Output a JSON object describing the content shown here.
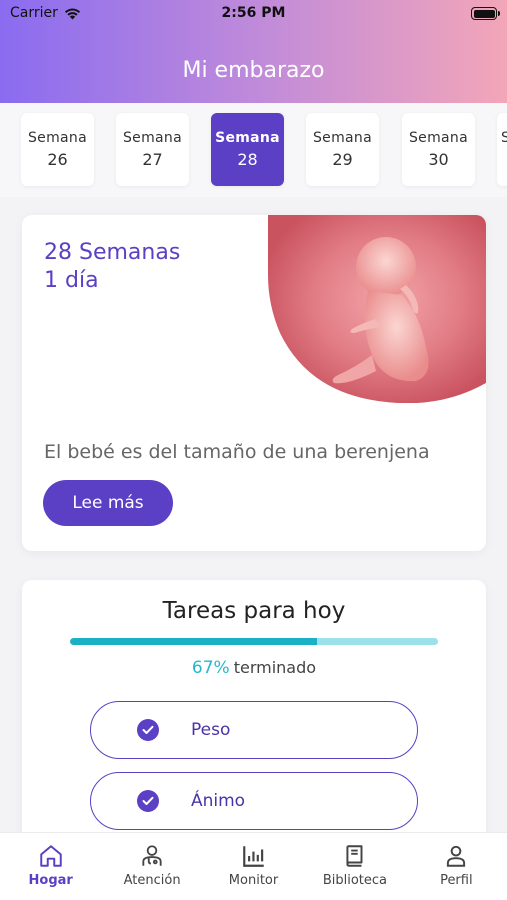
{
  "status_bar": {
    "carrier": "Carrier",
    "time": "2:56 PM"
  },
  "header": {
    "title": "Mi embarazo"
  },
  "weeks": {
    "label": "Semana",
    "items": [
      {
        "num": "26"
      },
      {
        "num": "27"
      },
      {
        "num": "28"
      },
      {
        "num": "29"
      },
      {
        "num": "30"
      }
    ],
    "partial_label": "S",
    "selected": "28"
  },
  "baby_card": {
    "weeks_line": "28 Semanas",
    "days_line": "1 día",
    "size_text": "El bebé es del tamaño de una berenjena",
    "read_more": "Lee más"
  },
  "tasks": {
    "title": "Tareas para hoy",
    "progress_percent": 67,
    "progress_label": "67%",
    "progress_suffix": "terminado",
    "items": [
      {
        "label": "Peso",
        "done": true
      },
      {
        "label": "Ánimo",
        "done": true
      }
    ]
  },
  "tabbar": {
    "items": [
      {
        "label": "Hogar",
        "icon": "home-icon",
        "active": true
      },
      {
        "label": "Atención",
        "icon": "doctor-icon",
        "active": false
      },
      {
        "label": "Monitor",
        "icon": "chart-icon",
        "active": false
      },
      {
        "label": "Biblioteca",
        "icon": "book-icon",
        "active": false
      },
      {
        "label": "Perfil",
        "icon": "person-icon",
        "active": false
      }
    ]
  },
  "colors": {
    "accent": "#5b3fc4",
    "progress": "#1ab0c6",
    "progress_track": "#9be0ea",
    "header_start": "#8a6cf0",
    "header_end": "#f3a6b8"
  }
}
